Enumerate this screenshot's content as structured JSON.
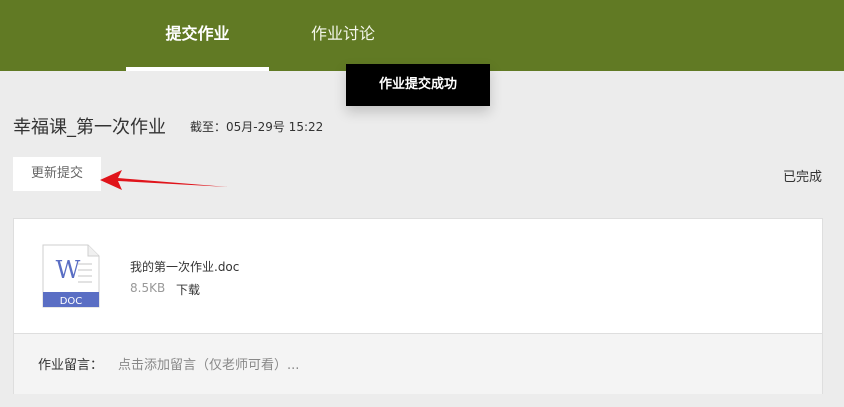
{
  "tabs": [
    {
      "label": "提交作业",
      "active": true
    },
    {
      "label": "作业讨论",
      "active": false
    }
  ],
  "toast": {
    "text": "作业提交成功"
  },
  "assignment": {
    "title": "幸福课_第一次作业",
    "deadline": "截至：05月-29号  15:22",
    "update_button": "更新提交",
    "status": "已完成"
  },
  "file": {
    "icon": "word-doc-icon",
    "icon_letter": "W",
    "icon_type": "DOC",
    "name": "我的第一次作业.doc",
    "size": "8.5KB",
    "download": "下载"
  },
  "comment": {
    "label": "作业留言：",
    "placeholder": "点击添加留言（仅老师可看）..."
  },
  "colors": {
    "topbar": "#617a24",
    "toast_bg": "#000000",
    "arrow": "#e0141b",
    "doc_icon_blue": "#5a6ec4"
  }
}
